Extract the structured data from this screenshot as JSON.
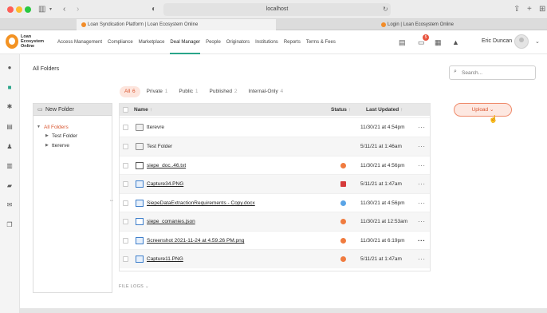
{
  "browser": {
    "url": "localhost",
    "tabs": [
      {
        "title": "Loan Syndication Platform | Loan Ecosystem Online"
      },
      {
        "title": "Login | Loan Ecosystem Online"
      }
    ]
  },
  "header": {
    "logo_text": "Loan Ecosystem Online",
    "nav": [
      {
        "label": "Access Management"
      },
      {
        "label": "Compliance"
      },
      {
        "label": "Marketplace"
      },
      {
        "label": "Deal Manager"
      },
      {
        "label": "People"
      },
      {
        "label": "Originators"
      },
      {
        "label": "Institutions"
      },
      {
        "label": "Reports"
      },
      {
        "label": "Terms & Fees"
      }
    ],
    "active_nav": "Deal Manager",
    "notification_count": "5",
    "user_name": "Eric Duncan"
  },
  "page": {
    "title": "All Folders",
    "search_placeholder": "Search..."
  },
  "filters": [
    {
      "label": "All",
      "count": "6",
      "active": true
    },
    {
      "label": "Private",
      "count": "1",
      "active": false
    },
    {
      "label": "Public",
      "count": "1",
      "active": false
    },
    {
      "label": "Published",
      "count": "2",
      "active": false
    },
    {
      "label": "Internal-Only",
      "count": "4",
      "active": false
    }
  ],
  "folder_panel": {
    "new_folder_label": "New Folder",
    "tree": {
      "root": "All Folders",
      "children": [
        "Test Folder",
        "ttererve"
      ]
    }
  },
  "table": {
    "columns": {
      "name": "Name",
      "status": "Status",
      "last_updated": "Last Updated"
    },
    "rows": [
      {
        "name": "tterevre",
        "type": "folder",
        "status": "",
        "date": "11/30/21 at 4:54pm"
      },
      {
        "name": "Test Folder",
        "type": "folder",
        "status": "",
        "date": "5/11/21 at 1:46am"
      },
      {
        "name": "siepe_doc..46.txt",
        "type": "doc",
        "status": "warning",
        "date": "11/30/21 at 4:56pm"
      },
      {
        "name": "Capture34.PNG",
        "type": "image",
        "status": "locked",
        "date": "5/11/21 at 1:47am"
      },
      {
        "name": "SiepeDataExtractionRequirements - Copy.docx",
        "type": "image",
        "status": "public",
        "date": "11/30/21 at 4:56pm"
      },
      {
        "name": "siepe_comanies.json",
        "type": "json",
        "status": "warning",
        "date": "11/30/21 at 12:53am"
      },
      {
        "name": "Screenshot 2021-11-24 at 4.59.26 PM.png",
        "type": "image",
        "status": "warning",
        "date": "11/30/21 at 6:19pm"
      },
      {
        "name": "Capture11.PNG",
        "type": "image",
        "status": "warning",
        "date": "5/11/21 at 1:47am"
      }
    ]
  },
  "file_logs_label": "FILE LOGS",
  "upload_label": "Upload",
  "colors": {
    "accent": "#d9552f",
    "accent_bg": "#fde5dd",
    "nav_active": "#2aa58a",
    "logo": "#f39324"
  }
}
